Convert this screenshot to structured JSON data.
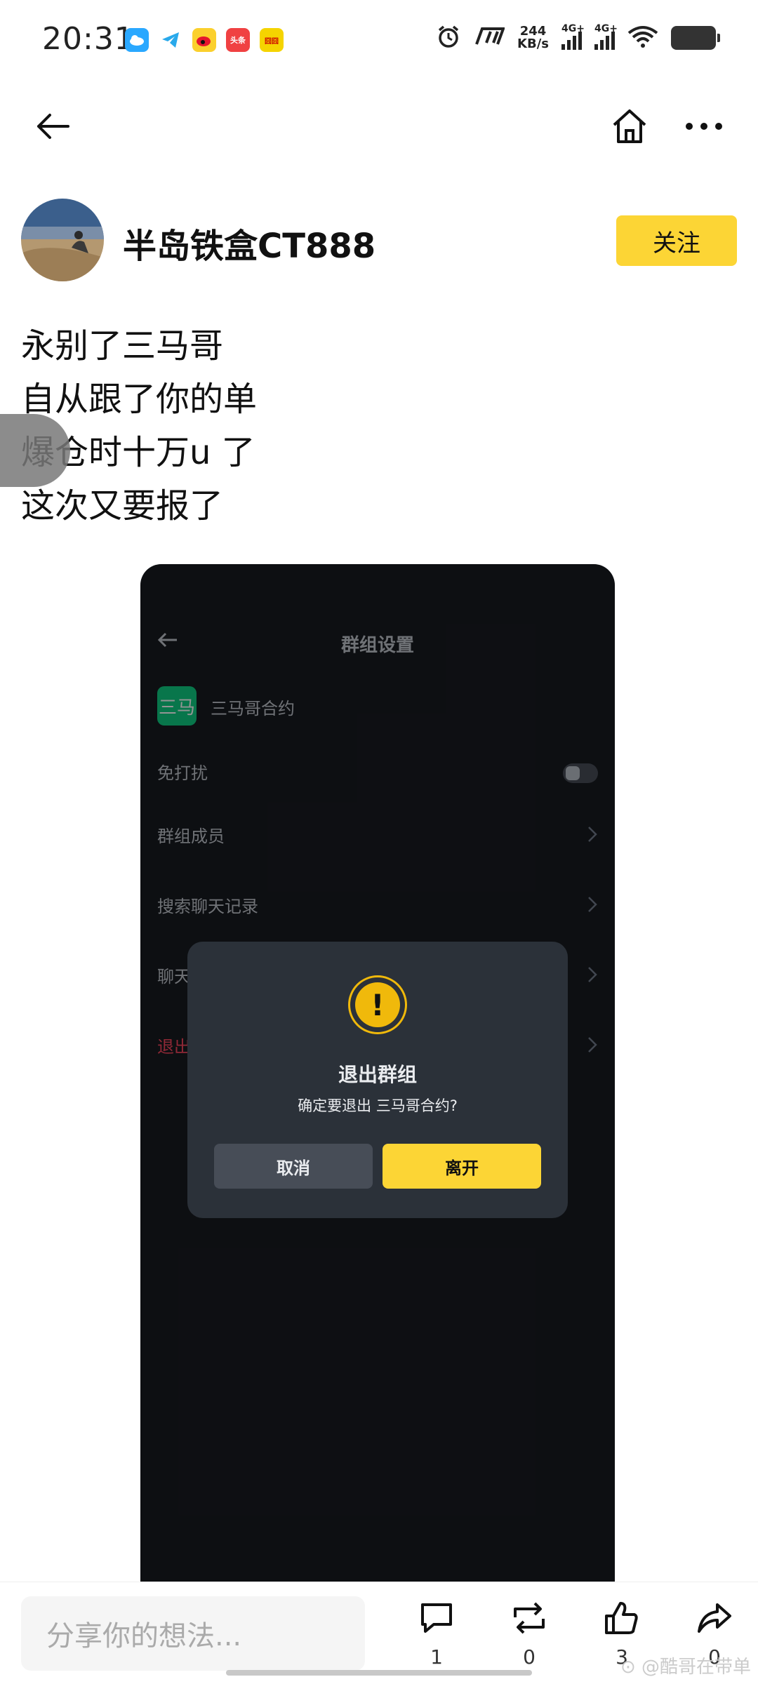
{
  "status_bar": {
    "time": "20:31",
    "net_speed_value": "244",
    "net_speed_unit": "KB/s",
    "sim1": "4G+",
    "sim2": "4G+",
    "app_icon_toutiao": "头条",
    "app_icon_other": "囧囧"
  },
  "author": {
    "name": "半岛铁盒CT888",
    "follow_label": "关注"
  },
  "post": {
    "lines": [
      "永别了三马哥",
      "自从跟了你的单",
      "爆仓时十万u 了",
      "这次又要报了"
    ]
  },
  "embedded": {
    "title": "群组设置",
    "group_avatar": "三马",
    "group_name": "三马哥合约",
    "rows": [
      "免打扰",
      "群组成员",
      "搜索聊天记录",
      "聊天",
      "退出"
    ],
    "dialog": {
      "title": "退出群组",
      "message": "确定要退出 三马哥合约?",
      "cancel": "取消",
      "leave": "离开"
    }
  },
  "bottom_bar": {
    "input_placeholder": "分享你的想法...",
    "comment_count": "1",
    "repost_count": "0",
    "like_count": "3",
    "share_count": "0",
    "watermark": "⊙ @酷哥在带单"
  },
  "colors": {
    "accent": "#fcd535",
    "dark_bg": "#181a20",
    "danger": "#f6465d"
  }
}
